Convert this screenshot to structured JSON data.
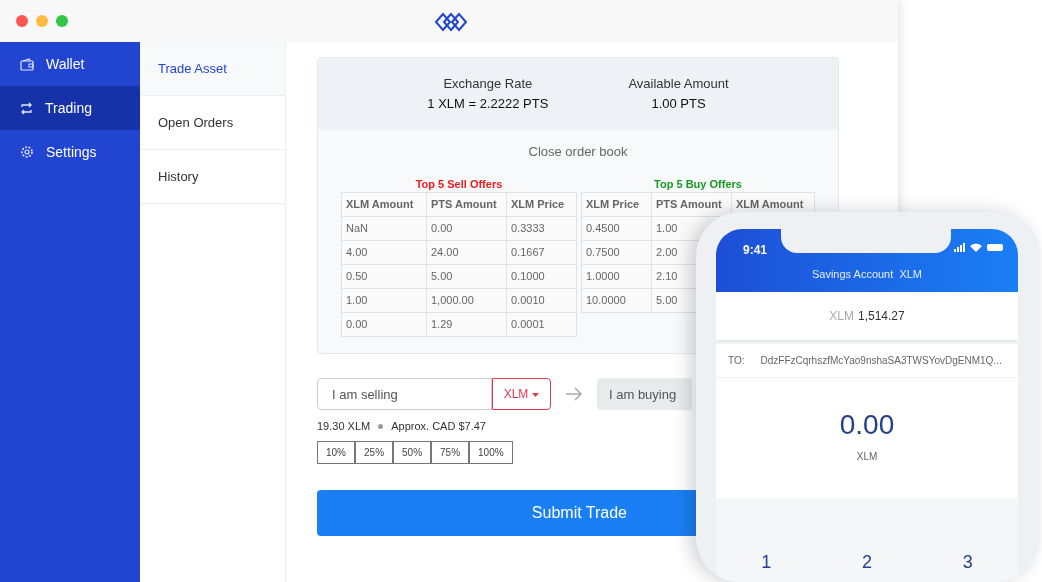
{
  "sidebar": {
    "items": [
      {
        "label": "Wallet",
        "selected": false
      },
      {
        "label": "Trading",
        "selected": true
      },
      {
        "label": "Settings",
        "selected": false
      }
    ]
  },
  "subnav": {
    "items": [
      {
        "label": "Trade Asset",
        "selected": true
      },
      {
        "label": "Open Orders",
        "selected": false
      },
      {
        "label": "History",
        "selected": false
      }
    ]
  },
  "summary": [
    {
      "label": "Exchange Rate",
      "value": "1 XLM = 2.2222 PTS"
    },
    {
      "label": "Available Amount",
      "value": "1.00 PTS"
    }
  ],
  "order_book": {
    "toggle": "Close order book",
    "sell": {
      "title": "Top 5 Sell Offers",
      "columns": [
        "XLM Amount",
        "PTS Amount",
        "XLM Price"
      ],
      "rows": [
        [
          "NaN",
          "0.00",
          "0.3333"
        ],
        [
          "4.00",
          "24.00",
          "0.1667"
        ],
        [
          "0.50",
          "5.00",
          "0.1000"
        ],
        [
          "1.00",
          "1,000.00",
          "0.0010"
        ],
        [
          "0.00",
          "1.29",
          "0.0001"
        ]
      ]
    },
    "buy": {
      "title": "Top 5 Buy Offers",
      "columns": [
        "XLM Price",
        "PTS Amount",
        "XLM Amount"
      ],
      "rows": [
        [
          "0.4500",
          "1.00"
        ],
        [
          "0.7500",
          "2.00"
        ],
        [
          "1.0000",
          "2.10"
        ],
        [
          "10.0000",
          "5.00"
        ]
      ]
    }
  },
  "trade": {
    "selling": {
      "placeholder": "I am selling"
    },
    "asset": "XLM",
    "buying": {
      "placeholder": "I am buying"
    },
    "balance": "19.30 XLM",
    "approx": "Approx. CAD $7.47",
    "percents": [
      "10%",
      "25%",
      "50%",
      "75%",
      "100%"
    ],
    "submit": "Submit Trade"
  },
  "phone": {
    "time": "9:41",
    "title": "Savings Account  XLM",
    "balance_unit": "XLM",
    "balance": "1,514.27",
    "to_label": "TO:",
    "to_address": "DdzFFzCqrhszfMcYao9nshaSA3TWSYovDgENM1Q...",
    "amount": "0.00",
    "amount_unit": "XLM",
    "keys": [
      "1",
      "2",
      "3"
    ]
  }
}
